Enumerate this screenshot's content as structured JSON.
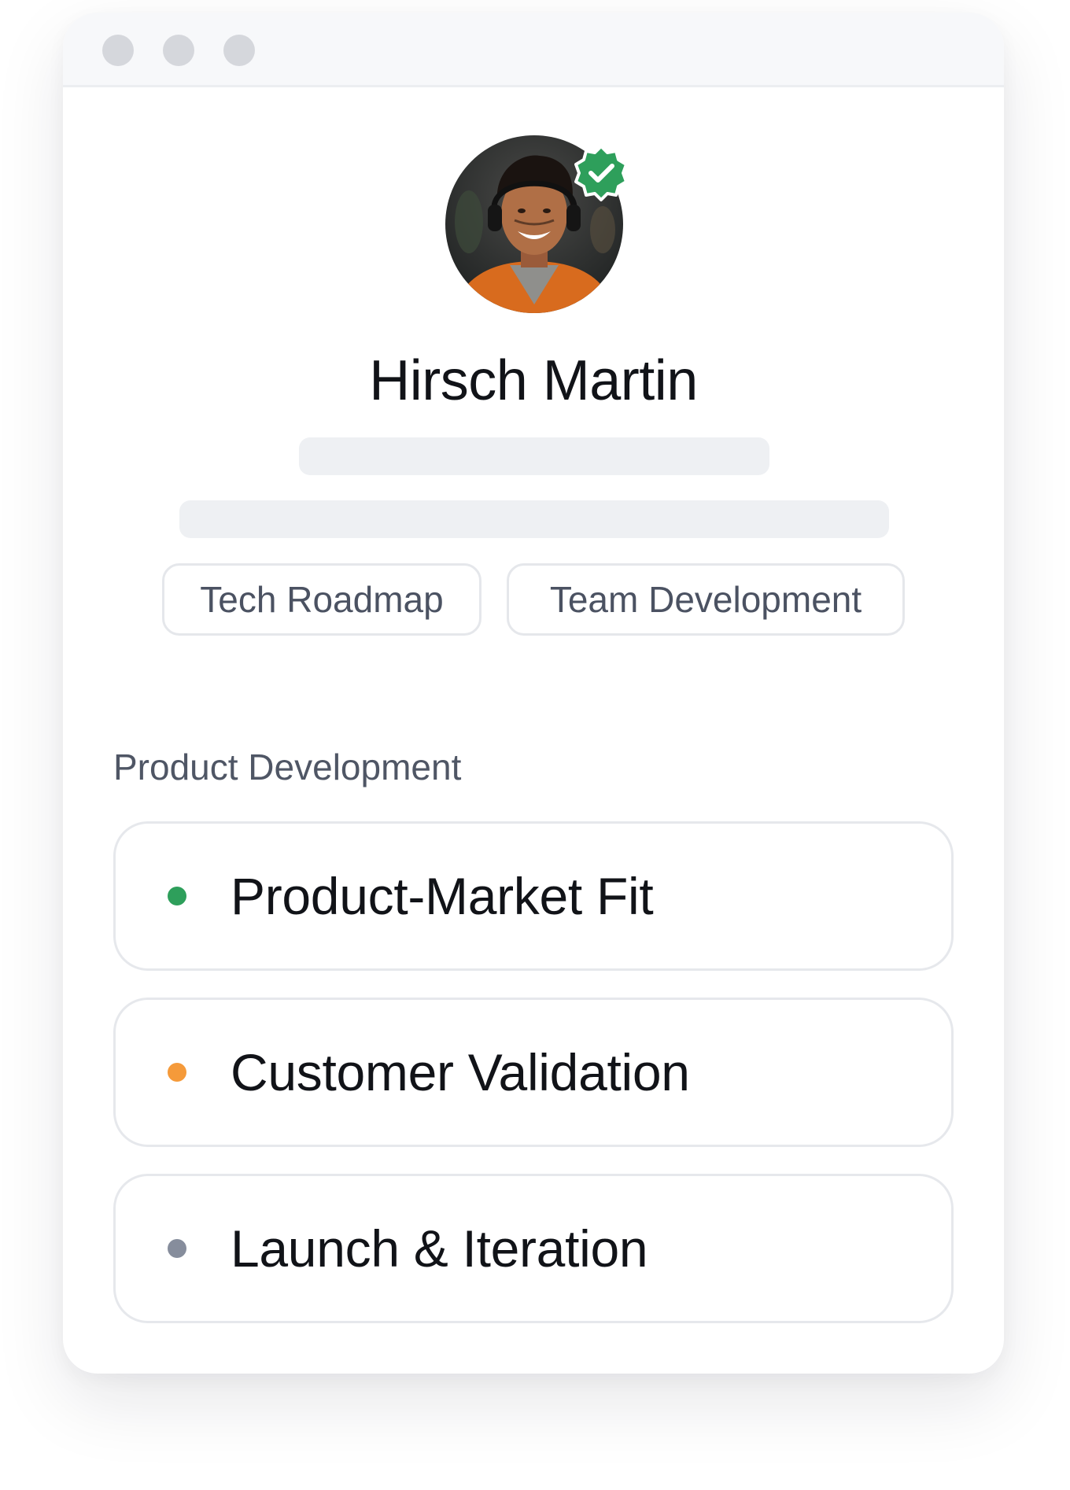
{
  "window": {
    "controls": [
      "close-dot",
      "minimize-dot",
      "maximize-dot"
    ]
  },
  "profile": {
    "name": "Hirsch Martin",
    "verified_icon": "verified-check-badge-icon",
    "verified_color": "#2e9f5b"
  },
  "tags": [
    {
      "label": "Tech Roadmap"
    },
    {
      "label": "Team Development"
    }
  ],
  "section": {
    "title": "Product Development",
    "items": [
      {
        "label": "Product-Market Fit",
        "status_color": "#2e9f5b"
      },
      {
        "label": "Customer Validation",
        "status_color": "#f59a3a"
      },
      {
        "label": "Launch & Iteration",
        "status_color": "#868d9c"
      }
    ]
  }
}
